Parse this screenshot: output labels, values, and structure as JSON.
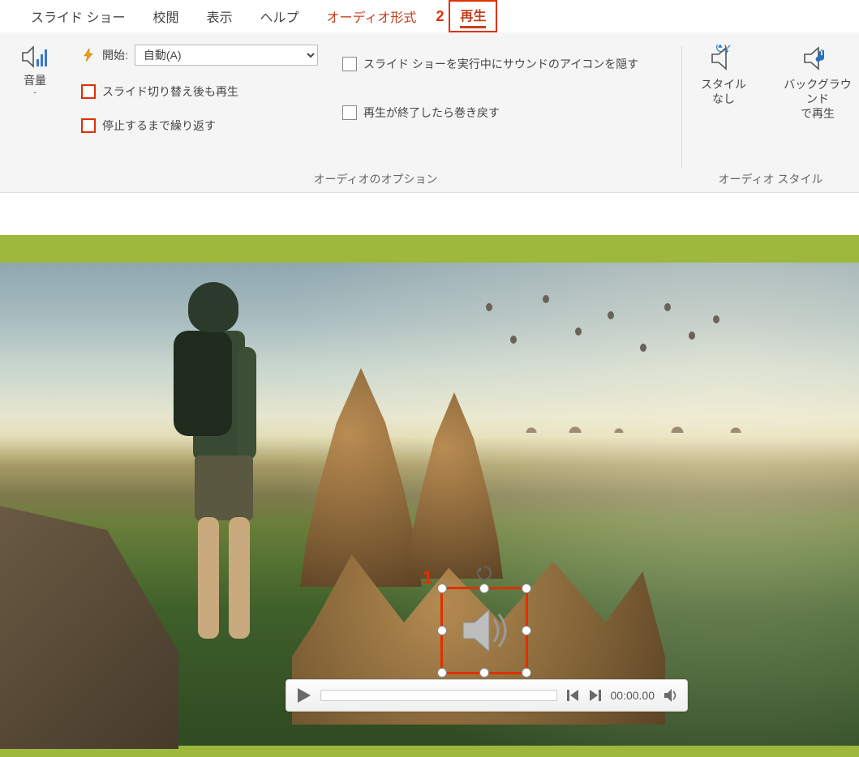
{
  "tabs": {
    "slideshow": "スライド ショー",
    "review": "校閲",
    "view": "表示",
    "help": "ヘルプ",
    "audio_format": "オーディオ形式",
    "playback": "再生"
  },
  "callouts": {
    "one": "1",
    "two": "2"
  },
  "ribbon": {
    "volume": {
      "label": "音量"
    },
    "options": {
      "start_label": "開始:",
      "start_value": "自動(A)",
      "play_across": "スライド切り替え後も再生",
      "loop_until": "停止するまで繰り返す",
      "hide_icon": "スライド ショーを実行中にサウンドのアイコンを隠す",
      "rewind": "再生が終了したら巻き戻す",
      "group_label": "オーディオのオプション"
    },
    "style": {
      "no_style_l1": "スタイル",
      "no_style_l2": "なし",
      "bg_play_l1": "バックグラウンド",
      "bg_play_l2": "で再生",
      "group_label": "オーディオ スタイル"
    }
  },
  "player": {
    "time": "00:00.00"
  },
  "colors": {
    "accent": "#c4401d",
    "highlight": "#e03000",
    "slide_bg": "#9db83c"
  }
}
